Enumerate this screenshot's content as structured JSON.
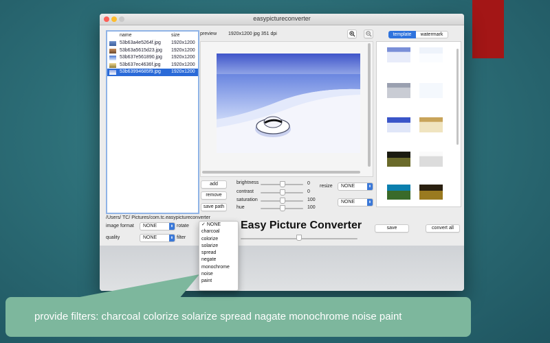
{
  "window": {
    "title": "easypictureconverter"
  },
  "file_list": {
    "headers": {
      "name": "name",
      "size": "size"
    },
    "rows": [
      {
        "name": "53b63a4e5264f.jpg",
        "size": "1920x1200",
        "selected": false
      },
      {
        "name": "53b63a5615d23.jpg",
        "size": "1920x1200",
        "selected": false
      },
      {
        "name": "53b637e561890.jpg",
        "size": "1920x1200",
        "selected": false
      },
      {
        "name": "53b637ec4636f.jpg",
        "size": "1920x1200",
        "selected": false
      },
      {
        "name": "53b63994685f9.jpg",
        "size": "1920x1200",
        "selected": true
      }
    ]
  },
  "preview": {
    "label": "preview",
    "info": "1920x1200 jpg 351 dpi",
    "zoom_in_icon": "zoom-in-icon",
    "zoom_out_icon": "zoom-out-icon"
  },
  "buttons": {
    "add": "add",
    "remove": "remove",
    "save_path": "save path",
    "save": "save",
    "convert_all": "convert all"
  },
  "adjustments": [
    {
      "label": "brightness",
      "value": "0",
      "level": 0.5
    },
    {
      "label": "contrast",
      "value": "0",
      "level": 0.5
    },
    {
      "label": "saturation",
      "value": "100",
      "level": 0.5
    },
    {
      "label": "hue",
      "value": "100",
      "level": 0.5
    }
  ],
  "resize": {
    "label": "resize",
    "value": "NONE",
    "second_value": "NONE"
  },
  "path": {
    "text": "/Users/  TC/  Pictures/com.tc.easypictureconverter"
  },
  "format": {
    "image_format_label": "image format",
    "image_format_value": "NONE",
    "rotate_label": "rotate",
    "quality_label": "quality",
    "quality_value": "NONE",
    "filter_label": "filter"
  },
  "filter_menu": {
    "checked_index": 0,
    "items": [
      "NONE",
      "charcoal",
      "colorize",
      "solarize",
      "spread",
      "negate",
      "monochrome",
      "noise",
      "paint"
    ]
  },
  "app_name": "Easy Picture Converter",
  "panel_tabs": {
    "template": "template",
    "watermark": "watermark",
    "active": "template"
  },
  "callout": {
    "text": "provide filters: charcoal colorize solarize spread nagate monochrome noise paint"
  },
  "colors": {
    "accent": "#2a6ad8",
    "callout": "#7db79d",
    "brand_red": "#a31616",
    "background": "#2d6f78"
  }
}
